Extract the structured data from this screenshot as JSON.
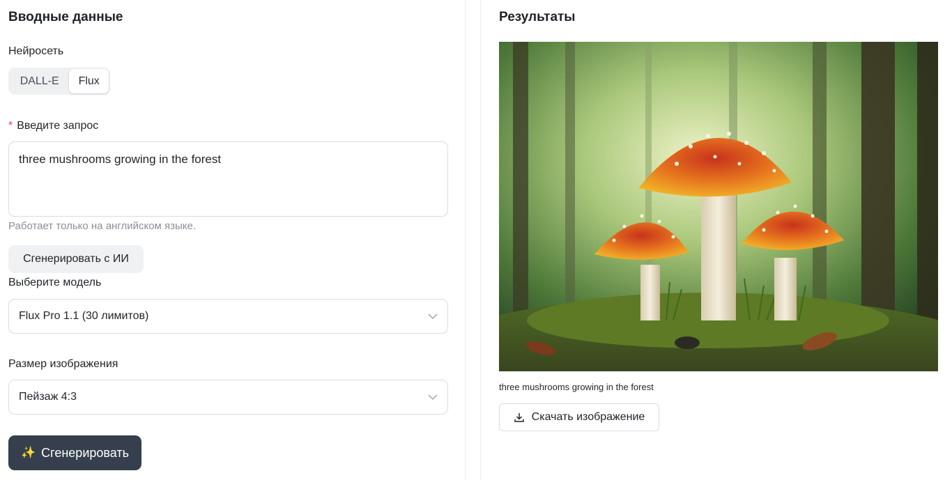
{
  "input_panel": {
    "title": "Вводные данные",
    "network_label": "Нейросеть",
    "network_options": [
      "DALL-E",
      "Flux"
    ],
    "network_selected": "Flux",
    "prompt_label": "Введите запрос",
    "prompt_required_mark": "*",
    "prompt_value": "three mushrooms growing in the forest",
    "prompt_hint": "Работает только на английском языке.",
    "ai_generate_button": "Сгенерировать с ИИ",
    "model_label": "Выберите модель",
    "model_value": "Flux Pro 1.1 (30 лимитов)",
    "size_label": "Размер изображения",
    "size_value": "Пейзаж 4:3",
    "generate_button": "Сгенерировать",
    "generate_icon": "✨"
  },
  "results_panel": {
    "title": "Результаты",
    "image_caption": "three mushrooms growing in the forest",
    "download_button": "Скачать изображение",
    "download_icon": "download-icon"
  },
  "colors": {
    "primary_button": "#353f4d",
    "required_star": "#e5484d",
    "hint_text": "#8a8f96"
  }
}
